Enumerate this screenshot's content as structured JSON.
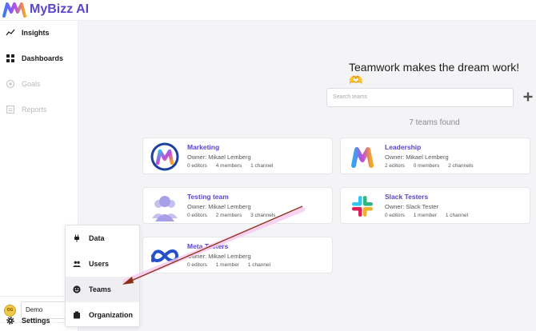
{
  "app": {
    "brand": "MyBizz AI"
  },
  "sidebar": {
    "items": [
      {
        "label": "Insights",
        "icon": "trend-icon",
        "enabled": true
      },
      {
        "label": "Dashboards",
        "icon": "grid-icon",
        "enabled": true
      },
      {
        "label": "Goals",
        "icon": "target-icon",
        "enabled": false
      },
      {
        "label": "Reports",
        "icon": "report-icon",
        "enabled": false
      }
    ],
    "workspace": {
      "avatar_text": "OG",
      "name": "Demo"
    },
    "settings_label": "Settings"
  },
  "menu": {
    "items": [
      {
        "label": "Data",
        "icon": "plug-icon"
      },
      {
        "label": "Users",
        "icon": "users-icon"
      },
      {
        "label": "Teams",
        "icon": "smile-icon",
        "active": true
      },
      {
        "label": "Organization",
        "icon": "building-icon"
      }
    ]
  },
  "main": {
    "tagline": "Teamwork makes the dream work! 🫶",
    "search_placeholder": "Search teams",
    "count_text": "7 teams found"
  },
  "teams": [
    {
      "name": "Marketing",
      "owner": "Owner: Mikael Lemberg",
      "editors": "0 editors",
      "members": "4 members",
      "channels": "1 channel",
      "icon": "mybizz-circle-icon"
    },
    {
      "name": "Leadership",
      "owner": "Owner: Mikael Lemberg",
      "editors": "2 editors",
      "members": "0 members",
      "channels": "2 channels",
      "icon": "mybizz-logo-icon"
    },
    {
      "name": "Testing team",
      "owner": "Owner: Mikael Lemberg",
      "editors": "0 editors",
      "members": "2 members",
      "channels": "3 channels",
      "icon": "people-icon"
    },
    {
      "name": "Slack Testers",
      "owner": "Owner: Slack Tester",
      "editors": "0 editors",
      "members": "1 member",
      "channels": "1 channel",
      "icon": "slack-icon"
    },
    {
      "name": "Meta Testers",
      "owner": "Owner: Mikael Lemberg",
      "editors": "0 editors",
      "members": "1 member",
      "channels": "1 channel",
      "icon": "meta-icon"
    }
  ],
  "colors": {
    "brand": "#5b45c9",
    "arrow": "#8b2e12",
    "highlight": "#f7c9ef"
  }
}
